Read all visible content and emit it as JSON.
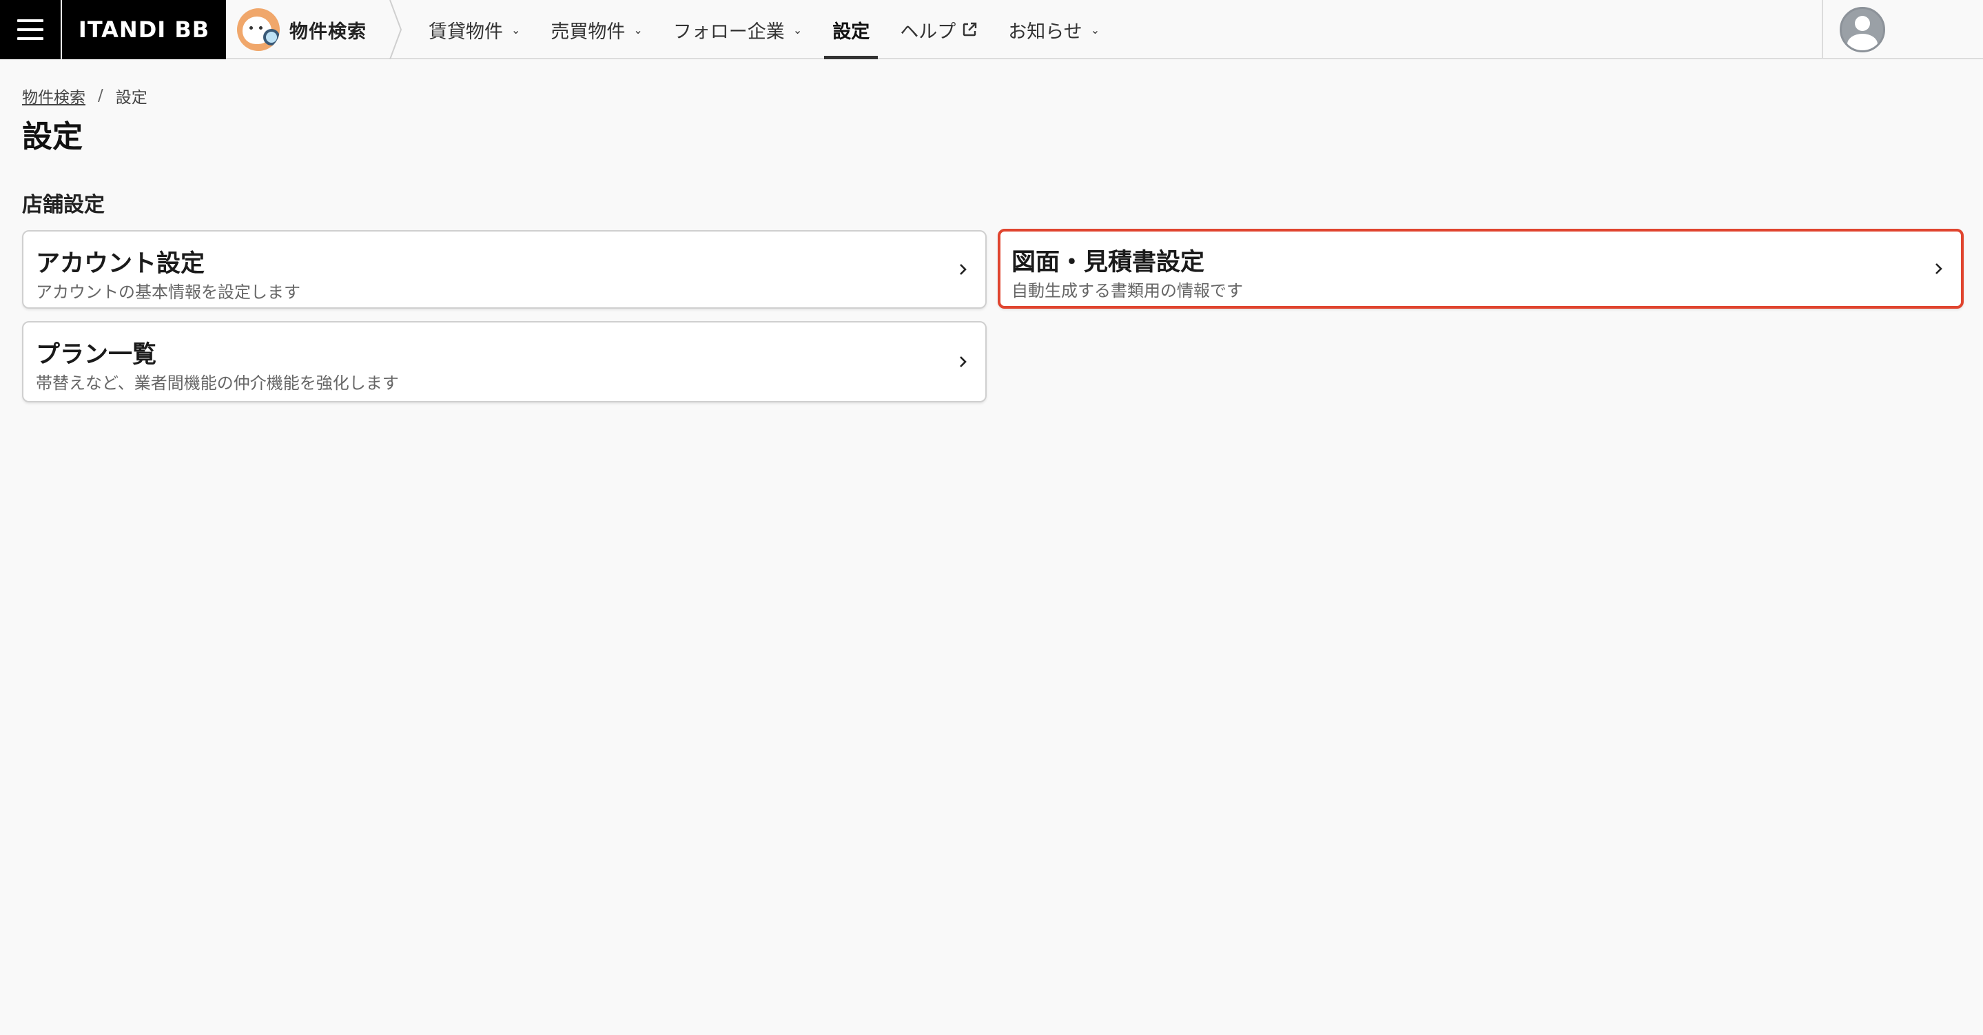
{
  "header": {
    "brand": "ITANDI BB",
    "product_label": "物件検索",
    "nav": [
      {
        "label": "賃貸物件",
        "has_dropdown": true
      },
      {
        "label": "売買物件",
        "has_dropdown": true
      },
      {
        "label": "フォロー企業",
        "has_dropdown": true
      },
      {
        "label": "設定",
        "active": true
      },
      {
        "label": "ヘルプ",
        "external": true
      },
      {
        "label": "お知らせ",
        "has_dropdown": true
      }
    ]
  },
  "breadcrumb": {
    "items": [
      "物件検索",
      "設定"
    ],
    "separator": "/"
  },
  "page": {
    "title": "設定",
    "section_title": "店舗設定"
  },
  "cards": [
    {
      "title": "アカウント設定",
      "description": "アカウントの基本情報を設定します"
    },
    {
      "title": "図面・見積書設定",
      "description": "自動生成する書類用の情報です",
      "highlighted": true
    },
    {
      "title": "プラン一覧",
      "description": "帯替えなど、業者間機能の仲介機能を強化します"
    }
  ],
  "colors": {
    "highlight_border": "#e0452f",
    "header_black": "#000000",
    "background": "#f9f9f9"
  }
}
